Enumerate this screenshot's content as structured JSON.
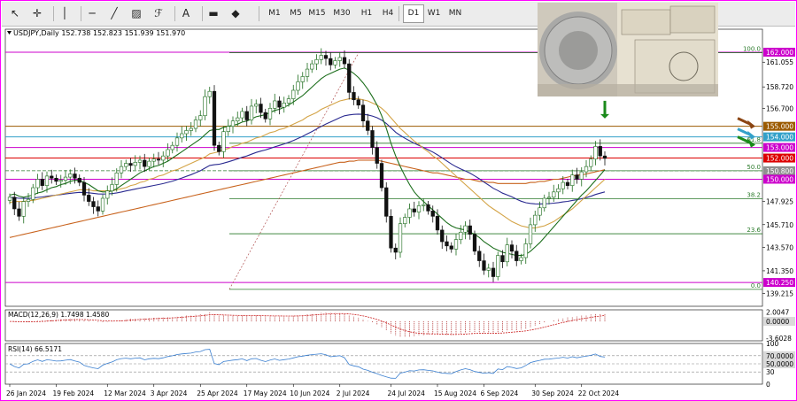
{
  "toolbar": {
    "tools": [
      {
        "name": "cursor-icon",
        "glyph": "↖"
      },
      {
        "name": "crosshair-icon",
        "glyph": "✛"
      },
      {
        "name": "vertical-line-icon",
        "glyph": "│"
      },
      {
        "name": "horizontal-line-icon",
        "glyph": "─"
      },
      {
        "name": "trendline-icon",
        "glyph": "╱"
      },
      {
        "name": "channel-icon",
        "glyph": "▨"
      },
      {
        "name": "fibonacci-icon",
        "glyph": "ℱ"
      },
      {
        "name": "text-icon",
        "glyph": "A"
      },
      {
        "name": "label-icon",
        "glyph": "▬"
      },
      {
        "name": "shapes-icon",
        "glyph": "◆"
      }
    ],
    "timeframes": [
      "M1",
      "M5",
      "M15",
      "M30",
      "H1",
      "H4",
      "D1",
      "W1",
      "MN"
    ],
    "active_timeframe": "D1"
  },
  "chart_data": {
    "type": "candlestick",
    "header": "USDJPY,Daily  152.738 152.823 151.939 151.970",
    "ylim": [
      138.0,
      163.5
    ],
    "price_ticks": [
      {
        "label": "162.000",
        "value": 162.0,
        "color": "#cc00cc"
      },
      {
        "label": "161.055",
        "value": 161.055
      },
      {
        "label": "158.720",
        "value": 158.72
      },
      {
        "label": "156.700",
        "value": 156.7
      },
      {
        "label": "155.000",
        "value": 155.0,
        "color": "#9b5a00"
      },
      {
        "label": "154.000",
        "value": 154.0,
        "color": "#33a1c9"
      },
      {
        "label": "153.000",
        "value": 153.0,
        "color": "#cc00cc"
      },
      {
        "label": "152.000",
        "value": 152.0,
        "color": "#dd0000"
      },
      {
        "label": "150.800",
        "value": 150.8,
        "color": "#909090"
      },
      {
        "label": "150.000",
        "value": 150.0,
        "color": "#cc00cc"
      },
      {
        "label": "147.925",
        "value": 147.925
      },
      {
        "label": "145.710",
        "value": 145.71
      },
      {
        "label": "143.570",
        "value": 143.57
      },
      {
        "label": "141.350",
        "value": 141.35
      },
      {
        "label": "140.250",
        "value": 140.25,
        "color": "#cc00cc"
      },
      {
        "label": "139.215",
        "value": 139.215
      }
    ],
    "levels": [
      {
        "value": 162.0,
        "color": "#cc00cc"
      },
      {
        "value": 155.0,
        "color": "#9b5a00"
      },
      {
        "value": 154.0,
        "color": "#33a1c9"
      },
      {
        "value": 153.0,
        "color": "#cc00cc"
      },
      {
        "value": 152.0,
        "color": "#dd0000"
      },
      {
        "value": 150.8,
        "color": "#2a7a2a",
        "dashed": true
      },
      {
        "value": 150.0,
        "color": "#cc00cc"
      },
      {
        "value": 140.25,
        "color": "#cc00cc"
      }
    ],
    "fib_levels": [
      {
        "label": "100.0",
        "value": 161.95
      },
      {
        "label": "61.8",
        "value": 153.4
      },
      {
        "label": "50.0",
        "value": 150.8
      },
      {
        "label": "38.2",
        "value": 148.15
      },
      {
        "label": "23.6",
        "value": 144.85
      },
      {
        "label": "0.0",
        "value": 139.6
      }
    ],
    "dates": [
      "26 Jan 2024",
      "19 Feb 2024",
      "12 Mar 2024",
      "3 Apr 2024",
      "25 Apr 2024",
      "17 May 2024",
      "10 Jun 2024",
      "2 Jul 2024",
      "24 Jul 2024",
      "15 Aug 2024",
      "6 Sep 2024",
      "30 Sep 2024",
      "22 Oct 2024"
    ],
    "closes": [
      148.3,
      147.2,
      146.5,
      147.9,
      148.1,
      149.2,
      150.0,
      149.4,
      150.3,
      150.1,
      149.8,
      149.9,
      150.2,
      150.5,
      150.1,
      149.7,
      148.5,
      147.9,
      147.4,
      147.0,
      148.2,
      148.9,
      149.5,
      150.6,
      151.2,
      151.5,
      151.3,
      151.6,
      151.8,
      151.2,
      151.7,
      151.9,
      151.8,
      152.2,
      152.8,
      153.2,
      153.9,
      154.3,
      154.6,
      154.8,
      155.6,
      156.0,
      157.8,
      158.3,
      153.2,
      152.6,
      154.5,
      155.0,
      155.5,
      155.8,
      156.4,
      155.6,
      156.9,
      157.1,
      156.3,
      155.7,
      156.7,
      157.4,
      156.8,
      157.2,
      157.6,
      158.4,
      159.2,
      159.7,
      160.4,
      160.9,
      161.3,
      161.7,
      161.4,
      160.8,
      161.2,
      161.5,
      160.9,
      158.2,
      157.5,
      157.0,
      155.5,
      154.6,
      153.0,
      151.5,
      149.2,
      146.5,
      143.5,
      143.1,
      145.8,
      146.4,
      147.2,
      146.9,
      147.5,
      147.6,
      147.0,
      146.5,
      145.2,
      144.1,
      143.7,
      143.4,
      144.3,
      145.0,
      145.6,
      144.8,
      143.2,
      142.3,
      141.4,
      141.6,
      140.8,
      142.8,
      142.2,
      143.8,
      143.2,
      142.3,
      142.6,
      143.9,
      145.7,
      146.6,
      147.3,
      148.2,
      148.3,
      148.8,
      149.1,
      149.7,
      149.4,
      150.4,
      150.0,
      150.7,
      151.2,
      151.9,
      153.1,
      152.2,
      151.97
    ],
    "ma_fast": [
      148.5,
      148.6,
      148.4,
      148.3,
      148.4,
      148.5,
      148.7,
      148.8,
      149.0,
      149.2,
      149.3,
      149.5,
      149.6,
      149.8,
      149.9,
      149.9,
      149.7,
      149.5,
      149.2,
      148.9,
      148.8,
      148.8,
      148.9,
      149.1,
      149.4,
      149.7,
      150.0,
      150.3,
      150.6,
      150.8,
      151.0,
      151.2,
      151.3,
      151.5,
      151.7,
      152.0,
      152.3,
      152.6,
      152.9,
      153.2,
      153.5,
      153.8,
      154.2,
      154.6,
      154.7,
      154.7,
      154.9,
      155.0,
      155.1,
      155.2,
      155.4,
      155.5,
      155.7,
      155.9,
      156.0,
      156.1,
      156.3,
      156.5,
      156.6,
      156.8,
      157.0,
      157.3,
      157.6,
      157.9,
      158.3,
      158.7,
      159.1,
      159.5,
      159.8,
      160.0,
      160.2,
      160.4,
      160.5,
      160.3,
      160.0,
      159.6,
      159.1,
      158.5,
      157.8,
      157.0,
      156.0,
      154.8,
      153.4,
      152.2,
      151.2,
      150.3,
      149.5,
      148.8,
      148.3,
      147.9,
      147.5,
      147.1,
      146.7,
      146.3,
      145.9,
      145.6,
      145.4,
      145.3,
      145.2,
      145.0,
      144.8,
      144.5,
      144.1,
      143.8,
      143.5,
      143.3,
      143.1,
      143.0,
      142.9,
      142.8,
      142.8,
      142.9,
      143.2,
      143.6,
      144.0,
      144.5,
      145.0,
      145.5,
      146.0,
      146.5,
      147.0,
      147.5,
      148.0,
      148.5,
      148.9,
      149.4,
      149.9,
      150.4,
      150.9
    ],
    "ma_mid": [
      147.8,
      147.9,
      147.9,
      147.9,
      148.0,
      148.0,
      148.1,
      148.2,
      148.3,
      148.4,
      148.5,
      148.6,
      148.7,
      148.8,
      148.9,
      149.0,
      149.0,
      149.0,
      148.9,
      148.9,
      148.9,
      148.9,
      148.9,
      149.0,
      149.1,
      149.2,
      149.4,
      149.5,
      149.7,
      149.8,
      150.0,
      150.1,
      150.3,
      150.4,
      150.6,
      150.8,
      150.9,
      151.1,
      151.3,
      151.5,
      151.7,
      151.9,
      152.1,
      152.4,
      152.5,
      152.6,
      152.8,
      152.9,
      153.1,
      153.2,
      153.4,
      153.5,
      153.7,
      153.9,
      154.0,
      154.2,
      154.4,
      154.5,
      154.7,
      154.8,
      155.0,
      155.2,
      155.4,
      155.6,
      155.9,
      156.1,
      156.3,
      156.6,
      156.8,
      157.0,
      157.2,
      157.4,
      157.5,
      157.6,
      157.6,
      157.6,
      157.5,
      157.4,
      157.2,
      157.0,
      156.7,
      156.3,
      155.8,
      155.3,
      154.8,
      154.4,
      154.0,
      153.6,
      153.3,
      152.9,
      152.6,
      152.2,
      151.9,
      151.5,
      151.1,
      150.7,
      150.3,
      149.9,
      149.5,
      149.1,
      148.7,
      148.3,
      147.9,
      147.5,
      147.2,
      146.9,
      146.6,
      146.3,
      146.0,
      145.8,
      145.6,
      145.5,
      145.4,
      145.4,
      145.5,
      145.6,
      145.8,
      146.0,
      146.3,
      146.6,
      146.9,
      147.2,
      147.6,
      148.0,
      148.4,
      148.8,
      149.2,
      149.6,
      150.0
    ],
    "ma_slow": [
      144.5,
      144.6,
      144.7,
      144.8,
      144.9,
      145.0,
      145.1,
      145.2,
      145.3,
      145.4,
      145.5,
      145.6,
      145.7,
      145.8,
      145.9,
      146.0,
      146.1,
      146.2,
      146.3,
      146.4,
      146.5,
      146.6,
      146.7,
      146.8,
      146.9,
      147.0,
      147.1,
      147.2,
      147.3,
      147.4,
      147.5,
      147.6,
      147.7,
      147.8,
      147.9,
      148.0,
      148.1,
      148.2,
      148.3,
      148.4,
      148.5,
      148.6,
      148.7,
      148.8,
      148.9,
      149.0,
      149.1,
      149.2,
      149.3,
      149.4,
      149.5,
      149.6,
      149.7,
      149.8,
      149.9,
      150.0,
      150.1,
      150.2,
      150.3,
      150.4,
      150.5,
      150.6,
      150.7,
      150.8,
      150.9,
      151.0,
      151.1,
      151.2,
      151.3,
      151.4,
      151.5,
      151.6,
      151.6,
      151.7,
      151.7,
      151.8,
      151.8,
      151.8,
      151.8,
      151.8,
      151.7,
      151.6,
      151.5,
      151.4,
      151.3,
      151.2,
      151.1,
      151.0,
      150.9,
      150.8,
      150.7,
      150.6,
      150.6,
      150.5,
      150.4,
      150.3,
      150.2,
      150.1,
      150.0,
      150.0,
      149.9,
      149.8,
      149.8,
      149.7,
      149.7,
      149.6,
      149.6,
      149.6,
      149.6,
      149.6,
      149.6,
      149.6,
      149.7,
      149.7,
      149.8,
      149.8,
      149.9,
      150.0,
      150.0,
      150.1,
      150.2,
      150.3,
      150.4,
      150.4,
      150.5,
      150.6,
      150.7,
      150.8,
      150.9
    ],
    "macd": {
      "label": "MACD(12,26,9) 1.7498 1.4580",
      "ticks": [
        {
          "label": "2.0047",
          "value": 2.0047
        },
        {
          "label": "0.0000",
          "value": 0.0,
          "boxed": true
        },
        {
          "label": "-3.6028",
          "value": -3.6028
        }
      ],
      "ylim": [
        -4.2,
        2.5
      ]
    },
    "rsi": {
      "label": "RSI(14) 66.5171",
      "ticks": [
        {
          "label": "100",
          "value": 100
        },
        {
          "label": "70.0000",
          "value": 70,
          "boxed": true
        },
        {
          "label": "50.0000",
          "value": 50,
          "boxed": true
        },
        {
          "label": "30",
          "value": 30
        },
        {
          "label": "0",
          "value": 0
        }
      ],
      "ylim": [
        0,
        100
      ]
    },
    "annotations": [
      {
        "type": "arrow-down",
        "color": "#1a8a1a",
        "index": 128,
        "value": 155.4
      },
      {
        "type": "arrow-left",
        "color": "#8b4513",
        "value": 155.0
      },
      {
        "type": "arrow-left",
        "color": "#33a1c9",
        "value": 154.0
      },
      {
        "type": "arrow-left",
        "color": "#1a8a1a",
        "value": 153.25
      }
    ],
    "colors": {
      "bull": "#1b6b1b",
      "bear": "#111111",
      "ma_fast": "#1c6e1c",
      "ma_mid": "#d4a447",
      "ma_slow": "#c8621c",
      "ma_long": "#2a2a90",
      "fib": "#2a7a2a"
    }
  }
}
